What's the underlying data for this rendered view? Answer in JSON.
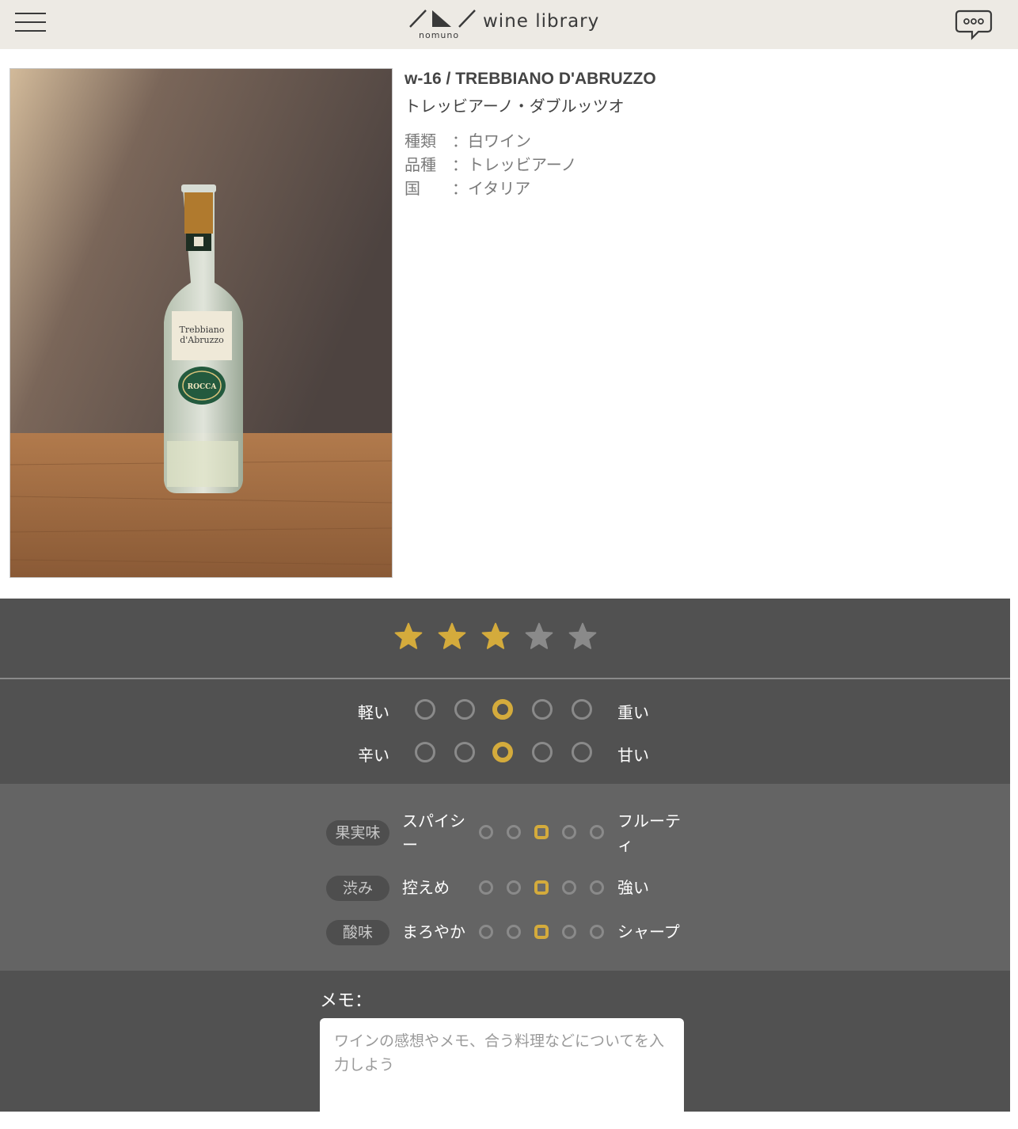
{
  "header": {
    "brand_sub": "nomuno",
    "brand_name": "wine library",
    "menu_icon": "hamburger-menu-icon",
    "chat_icon": "chat-bubble-icon"
  },
  "wine": {
    "title": "w-16 / TREBBIANO D'ABRUZZO",
    "kana": "トレッビアーノ・ダブルッツオ",
    "specs": [
      {
        "key": "種類",
        "sep": "：",
        "value": "白ワイン"
      },
      {
        "key": "品種",
        "sep": "：",
        "value": "トレッビアーノ"
      },
      {
        "key": "国",
        "sep": "：",
        "value": "イタリア"
      }
    ],
    "label": {
      "line1": "Trebbiano",
      "line2": "d'Abruzzo",
      "brand": "ROCCA"
    }
  },
  "rating": {
    "value": 3,
    "max": 5,
    "active_color": "#d4ab3c",
    "inactive_color": "#8a8a8a"
  },
  "scales": [
    {
      "left": "軽い",
      "right": "重い",
      "value": 3,
      "max": 5
    },
    {
      "left": "辛い",
      "right": "甘い",
      "value": 3,
      "max": 5
    }
  ],
  "taste": [
    {
      "tag": "果実味",
      "left": "スパイシー",
      "right": "フルーティ",
      "value": 3,
      "max": 5
    },
    {
      "tag": "渋み",
      "left": "控えめ",
      "right": "強い",
      "value": 3,
      "max": 5
    },
    {
      "tag": "酸味",
      "left": "まろやか",
      "right": "シャープ",
      "value": 3,
      "max": 5
    }
  ],
  "memo": {
    "label": "メモ：",
    "placeholder": "ワインの感想やメモ、合う料理などについてを入力しよう"
  }
}
